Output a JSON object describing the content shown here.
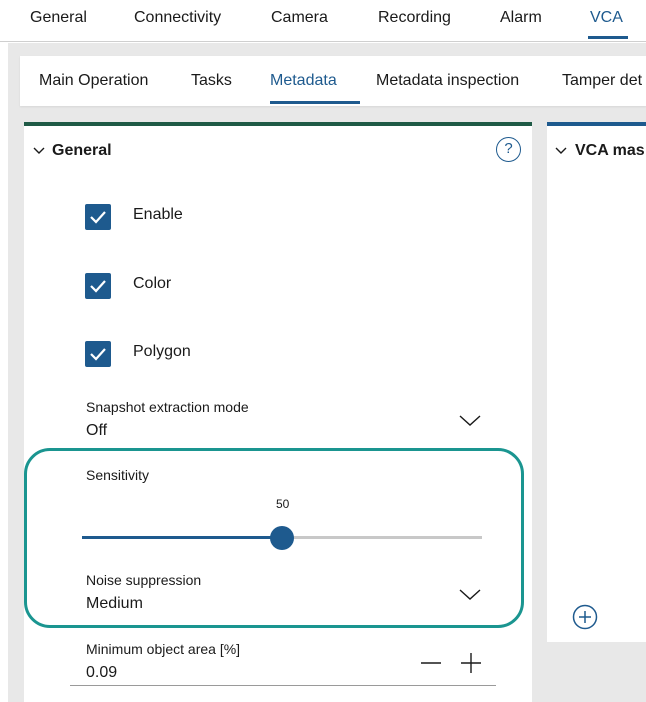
{
  "top_tabs": [
    {
      "label": "General"
    },
    {
      "label": "Connectivity"
    },
    {
      "label": "Camera"
    },
    {
      "label": "Recording"
    },
    {
      "label": "Alarm"
    },
    {
      "label": "VCA"
    }
  ],
  "active_top_tab": "VCA",
  "sub_tabs": [
    {
      "label": "Main Operation"
    },
    {
      "label": "Tasks"
    },
    {
      "label": "Metadata"
    },
    {
      "label": "Metadata inspection"
    },
    {
      "label": "Tamper det"
    }
  ],
  "active_sub_tab": "Metadata",
  "general_panel": {
    "title": "General",
    "help_glyph": "?",
    "checkboxes": [
      {
        "label": "Enable",
        "checked": true
      },
      {
        "label": "Color",
        "checked": true
      },
      {
        "label": "Polygon",
        "checked": true
      }
    ],
    "snapshot_mode": {
      "label": "Snapshot extraction mode",
      "value": "Off"
    },
    "sensitivity": {
      "label": "Sensitivity",
      "value": 50,
      "value_text": "50",
      "min": 0,
      "max": 100
    },
    "noise_suppression": {
      "label": "Noise suppression",
      "value": "Medium"
    },
    "min_object_area": {
      "label": "Minimum object area [%]",
      "value": "0.09"
    }
  },
  "vca_panel": {
    "title": "VCA mas"
  },
  "colors": {
    "accent": "#1e5a8e",
    "general_header_bar": "#1f5a46",
    "highlight_outline": "#1a9590"
  },
  "icons": [
    "chevron-down-icon",
    "help-icon",
    "check-icon",
    "minus-icon",
    "plus-icon",
    "add-circle-icon"
  ]
}
